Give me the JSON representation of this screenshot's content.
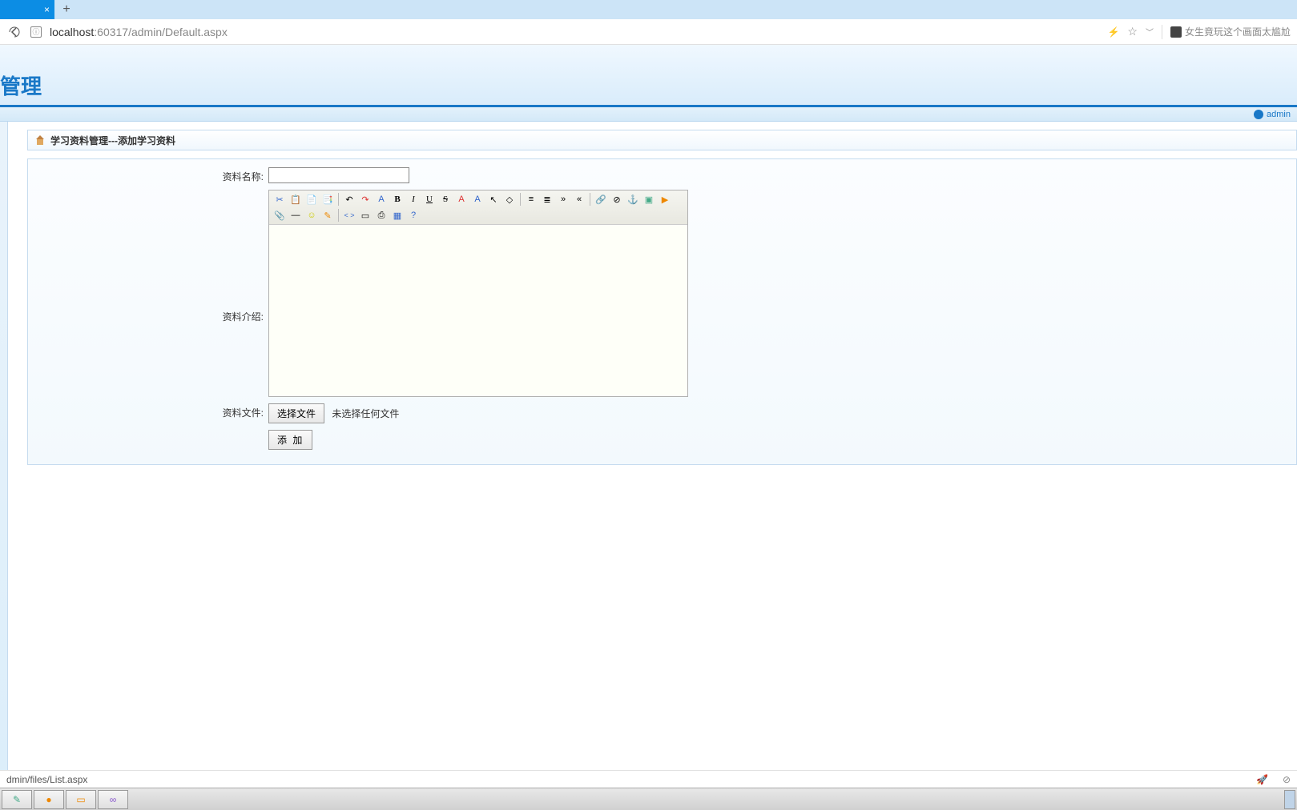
{
  "browser": {
    "url_host": "localhost",
    "url_port": ":60317",
    "url_path": "/admin/Default.aspx",
    "bookmark_text": "女生竟玩这个画面太尴尬"
  },
  "header": {
    "title": "管理",
    "user": "admin"
  },
  "breadcrumb": {
    "text": "学习资料管理---添加学习资料"
  },
  "form": {
    "name_label": "资料名称:",
    "name_value": "",
    "intro_label": "资料介绍:",
    "file_label": "资料文件:",
    "file_button": "选择文件",
    "file_status": "未选择任何文件",
    "submit": "添 加"
  },
  "toolbar_icons": {
    "cut": "✂",
    "copy": "📋",
    "paste": "📄",
    "pasteword": "📑",
    "undo": "↶",
    "redo": "↷",
    "font": "A",
    "bold": "B",
    "italic": "I",
    "underline": "U",
    "strike": "S",
    "fontcolor": "A",
    "bgcolor": "A",
    "cursor": "↖",
    "eraser": "◇",
    "align": "≡",
    "list_ol": "≣",
    "indent": "»",
    "outdent": "«",
    "link": "🔗",
    "unlink": "⊘",
    "anchor": "⚓",
    "image": "▣",
    "flash": "▶",
    "attach": "📎",
    "hr": "—",
    "emoji": "☺",
    "note": "✎",
    "html": "< >",
    "page": "▭",
    "print": "⎙",
    "date": "▦",
    "help": "?"
  },
  "status": {
    "text": "dmin/files/List.aspx",
    "rocket": "🚀",
    "bug": "⊘"
  },
  "taskbar": {
    "items": [
      "paint",
      "chrome",
      "notepad",
      "vs"
    ]
  }
}
